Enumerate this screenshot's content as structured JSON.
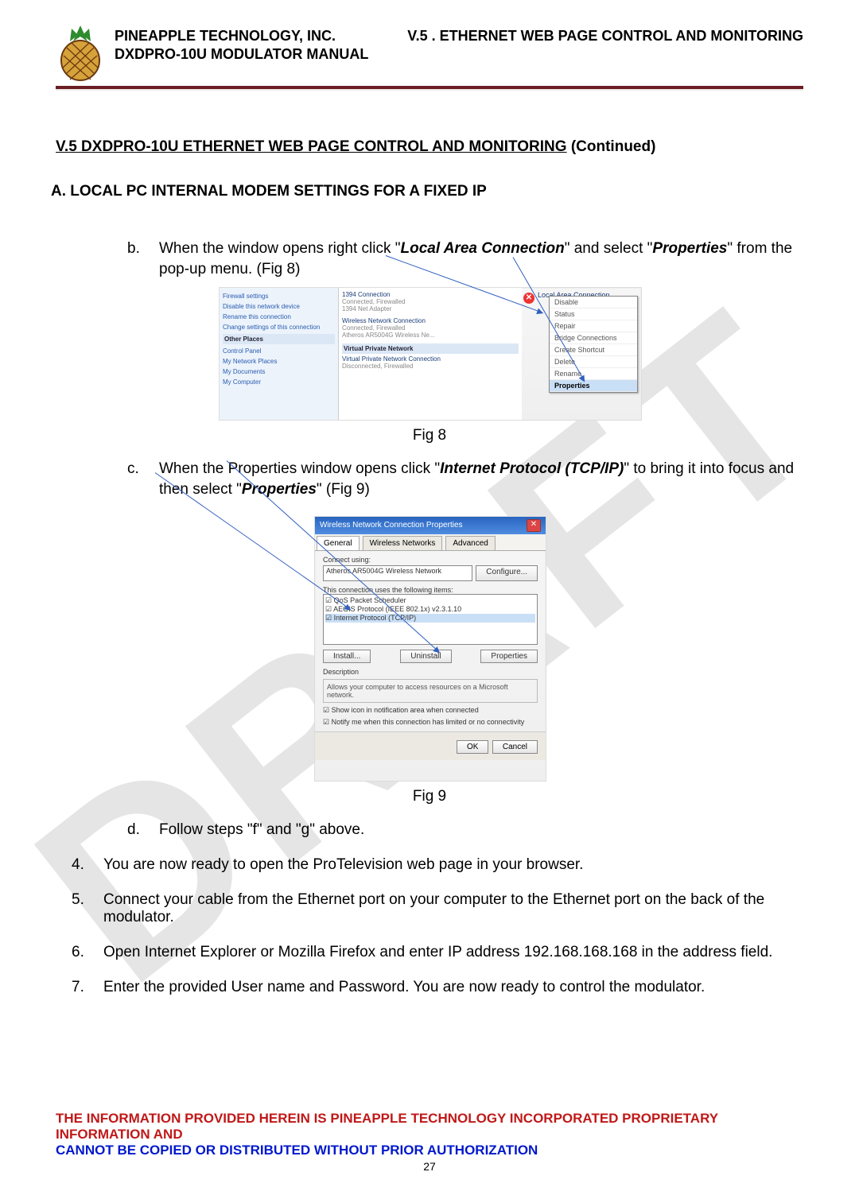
{
  "header": {
    "company": "PINEAPPLE TECHNOLOGY, INC.",
    "manual": "DXDPRO-10U MODULATOR MANUAL",
    "chapter": "V.5 . ETHERNET WEB PAGE CONTROL AND MONITORING"
  },
  "watermark": "DRAFT",
  "section": {
    "title_underlined": "V.5  DXDPRO-10U ETHERNET WEB PAGE CONTROL AND MONITORING",
    "title_suffix": " (Continued)"
  },
  "subsection_a": "A.   LOCAL PC INTERNAL MODEM SETTINGS FOR A FIXED IP",
  "item_b": {
    "marker": "b.",
    "pre": "When the window opens right click \"",
    "em1": "Local Area Connection",
    "mid": "\" and select \"",
    "em2": "Properties",
    "post": "\" from the pop-up menu. (Fig 8)"
  },
  "fig8": {
    "caption": "Fig 8",
    "left_tasks": [
      "Firewall settings",
      "Disable this network device",
      "Rename this connection",
      "Change settings of this connection"
    ],
    "left_places_hdr": "Other Places",
    "left_places": [
      "Control Panel",
      "My Network Places",
      "My Documents",
      "My Computer"
    ],
    "mid_groups": [
      {
        "title": "",
        "items": [
          "1394 Connection",
          "Connected, Firewalled",
          "1394 Net Adapter"
        ]
      },
      {
        "title": "",
        "items": [
          "Wireless Network Connection",
          "Connected, Firewalled",
          "Atheros AR5004G Wireless Ne..."
        ]
      },
      {
        "title": "Virtual Private Network",
        "items": [
          "Virtual Private Network Connection",
          "Disconnected, Firewalled"
        ]
      }
    ],
    "right_label": "Local Area Connection",
    "menu": [
      "Disable",
      "Status",
      "Repair",
      "Bridge Connections",
      "Create Shortcut",
      "Delete",
      "Rename",
      "Properties"
    ],
    "menu_highlight_index": 7
  },
  "item_c": {
    "marker": "c.",
    "pre": "When the Properties window opens click \"",
    "em1": "Internet Protocol (TCP/IP)",
    "mid": "\" to bring it into focus and then select \"",
    "em2": "Properties",
    "post": "\" (Fig 9)"
  },
  "fig9": {
    "caption": "Fig 9",
    "title": "Wireless Network Connection Properties",
    "tabs": [
      "General",
      "Wireless Networks",
      "Advanced"
    ],
    "connect_using_label": "Connect using:",
    "adapter": "Atheros AR5004G Wireless Network",
    "configure_btn": "Configure...",
    "items_label": "This connection uses the following items:",
    "items": [
      "QoS Packet Scheduler",
      "AEGIS Protocol (IEEE 802.1x) v2.3.1.10",
      "Internet Protocol (TCP/IP)"
    ],
    "btn_install": "Install...",
    "btn_uninstall": "Uninstall",
    "btn_props": "Properties",
    "desc_hdr": "Description",
    "desc": "Allows your computer to access resources on a Microsoft network.",
    "chk1": "Show icon in notification area when connected",
    "chk2": "Notify me when this connection has limited or no connectivity",
    "ok": "OK",
    "cancel": "Cancel"
  },
  "item_d": {
    "marker": "d.",
    "text": "Follow steps \"f\" and \"g\" above."
  },
  "num4": {
    "marker": "4.",
    "text": "You are now ready to open the ProTelevision web page in your browser."
  },
  "num5": {
    "marker": "5.",
    "text": "Connect your cable from the Ethernet port on your computer to the Ethernet port on the back of the modulator."
  },
  "num6": {
    "marker": "6.",
    "text": "Open Internet Explorer or Mozilla Firefox and enter IP address 192.168.168.168 in the address field."
  },
  "num7": {
    "marker": "7.",
    "text": "Enter the provided User name and Password.  You are now ready to control the modulator."
  },
  "footer": {
    "line1": "THE INFORMATION PROVIDED HEREIN IS PINEAPPLE TECHNOLOGY INCORPORATED PROPRIETARY INFORMATION AND",
    "line2": "CANNOT BE COPIED OR DISTRIBUTED WITHOUT PRIOR AUTHORIZATION",
    "page": "27"
  }
}
